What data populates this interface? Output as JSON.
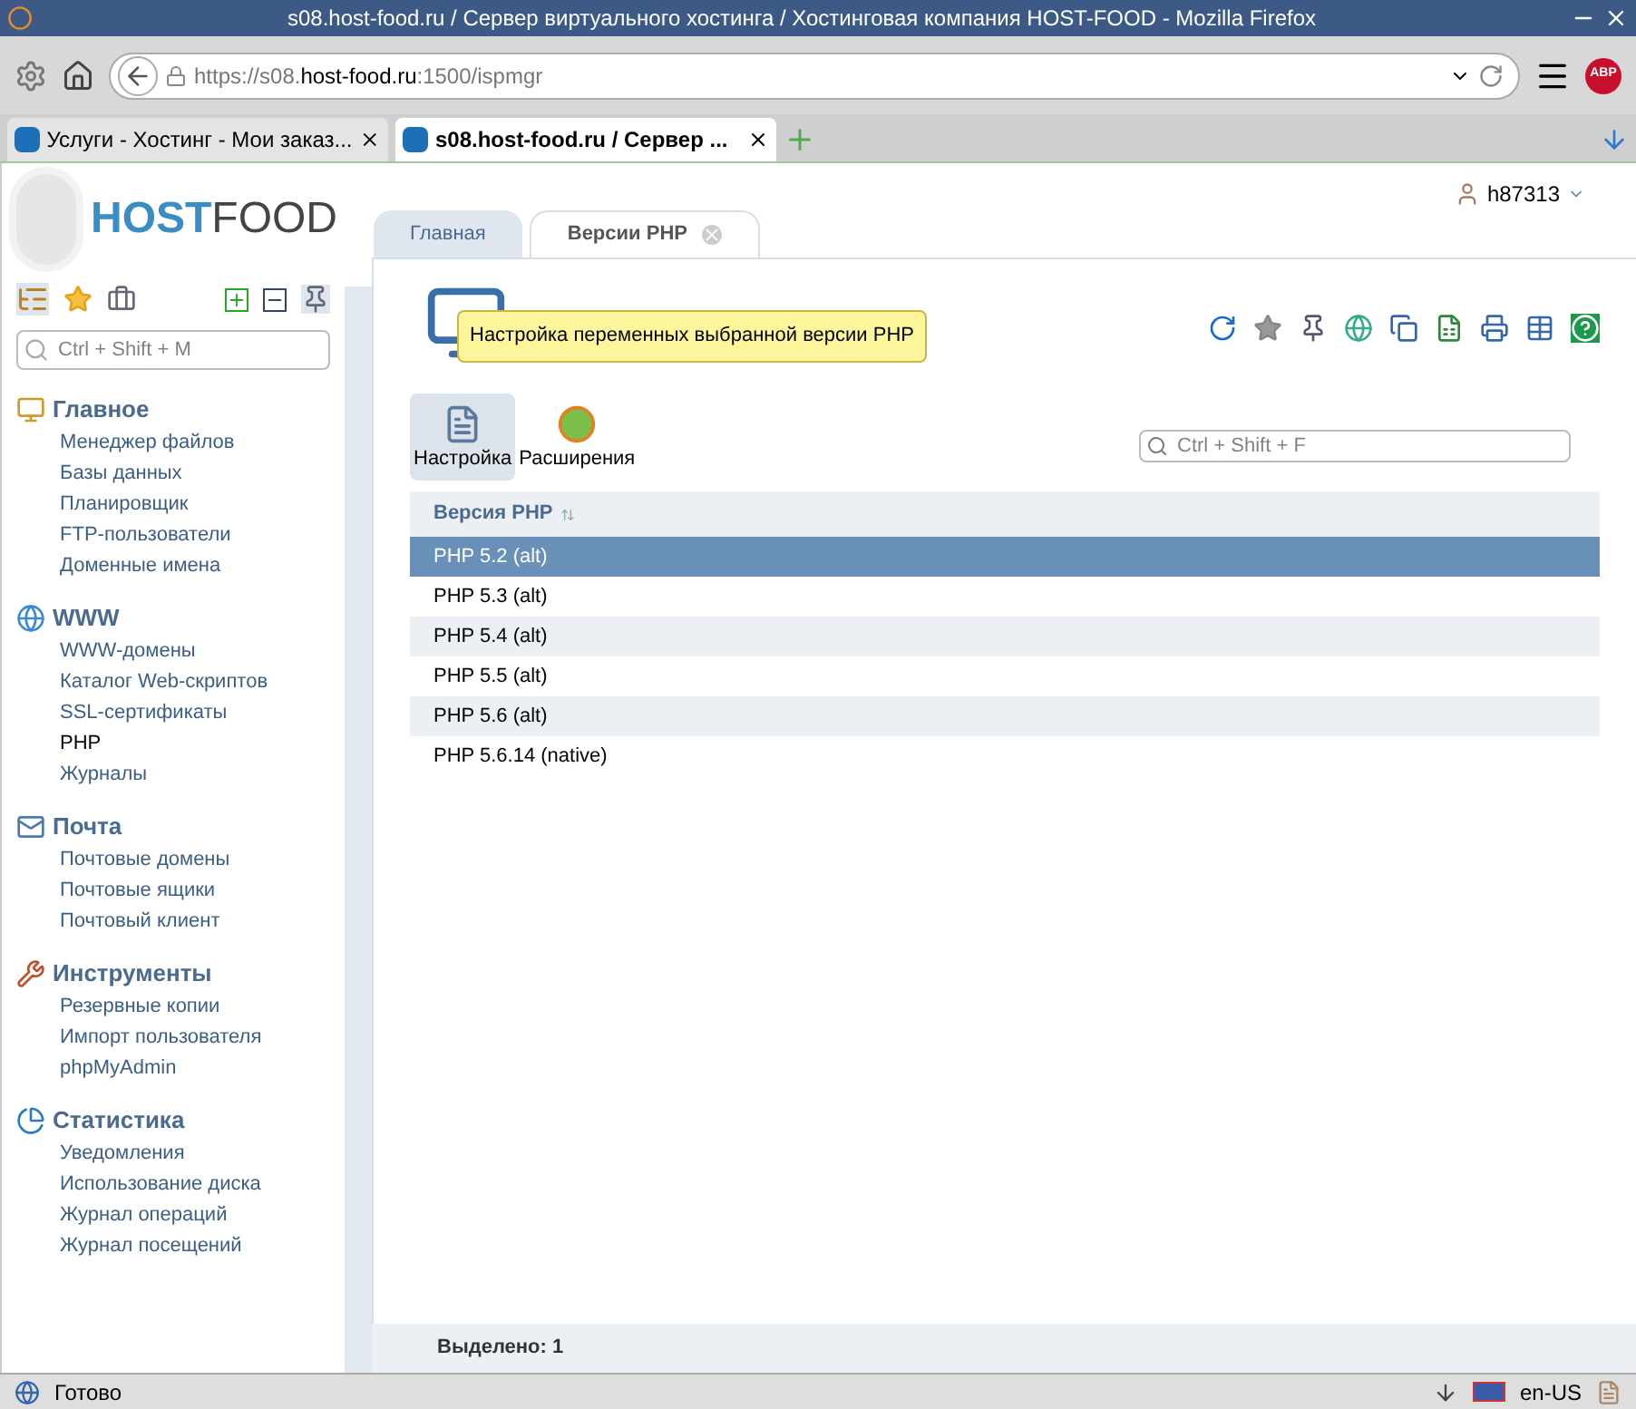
{
  "window": {
    "title": "s08.host-food.ru / Сервер виртуального хостинга / Хостинговая компания HOST-FOOD - Mozilla Firefox"
  },
  "browser": {
    "address_host_prefix": "https://s08.",
    "address_host": "host-food.ru",
    "address_rest": ":1500/ispmgr",
    "addon_badge": "ABP",
    "tabs": [
      {
        "label": "Услуги - Хостинг - Мои заказ...",
        "selected": false
      },
      {
        "label": "s08.host-food.ru / Сервер ...",
        "selected": true
      }
    ]
  },
  "header": {
    "logo": {
      "part_1": "HOST",
      "part_2": "FOOD"
    },
    "user": "h87313"
  },
  "sidebar": {
    "search": {
      "placeholder": "Ctrl + Shift + M"
    },
    "sections": [
      {
        "title": "Главное",
        "items": [
          {
            "label": "Менеджер файлов",
            "selected": false
          },
          {
            "label": "Базы данных",
            "selected": false
          },
          {
            "label": "Планировщик",
            "selected": false
          },
          {
            "label": "FTP-пользователи",
            "selected": false
          },
          {
            "label": "Доменные имена",
            "selected": false
          }
        ]
      },
      {
        "title": "WWW",
        "items": [
          {
            "label": "WWW-домены",
            "selected": false
          },
          {
            "label": "Каталог Web-скриптов",
            "selected": false
          },
          {
            "label": "SSL-сертификаты",
            "selected": false
          },
          {
            "label": "PHP",
            "selected": true
          },
          {
            "label": "Журналы",
            "selected": false
          }
        ]
      },
      {
        "title": "Почта",
        "items": [
          {
            "label": "Почтовые домены",
            "selected": false
          },
          {
            "label": "Почтовые ящики",
            "selected": false
          },
          {
            "label": "Почтовый клиент",
            "selected": false
          }
        ]
      },
      {
        "title": "Инструменты",
        "items": [
          {
            "label": "Резервные копии",
            "selected": false
          },
          {
            "label": "Импорт пользователя",
            "selected": false
          },
          {
            "label": "phpMyAdmin",
            "selected": false
          }
        ]
      },
      {
        "title": "Статистика",
        "items": [
          {
            "label": "Уведомления",
            "selected": false
          },
          {
            "label": "Использование диска",
            "selected": false
          },
          {
            "label": "Журнал операций",
            "selected": false
          },
          {
            "label": "Журнал посещений",
            "selected": false
          }
        ]
      }
    ]
  },
  "main": {
    "tabs": [
      {
        "label": "Главная",
        "selected": false,
        "closable": false
      },
      {
        "label": "Версии PHP",
        "selected": true,
        "closable": true
      }
    ],
    "tooltip": "Настройка переменных выбранной версии PHP",
    "actions": [
      {
        "label": "Настройка",
        "selected": true
      },
      {
        "label": "Расширения",
        "selected": false
      }
    ],
    "search": {
      "placeholder": "Ctrl + Shift + F"
    },
    "table": {
      "columns": [
        "Версия PHP"
      ],
      "rows": [
        {
          "cell": "PHP 5.2 (alt)",
          "selected": true
        },
        {
          "cell": "PHP 5.3 (alt)",
          "selected": false
        },
        {
          "cell": "PHP 5.4 (alt)",
          "selected": false
        },
        {
          "cell": "PHP 5.5 (alt)",
          "selected": false
        },
        {
          "cell": "PHP 5.6 (alt)",
          "selected": false
        },
        {
          "cell": "PHP 5.6.14 (native)",
          "selected": false
        }
      ]
    },
    "footer": "Выделено: 1"
  },
  "status_bar": {
    "text": "Готово",
    "locale": "en-US"
  }
}
